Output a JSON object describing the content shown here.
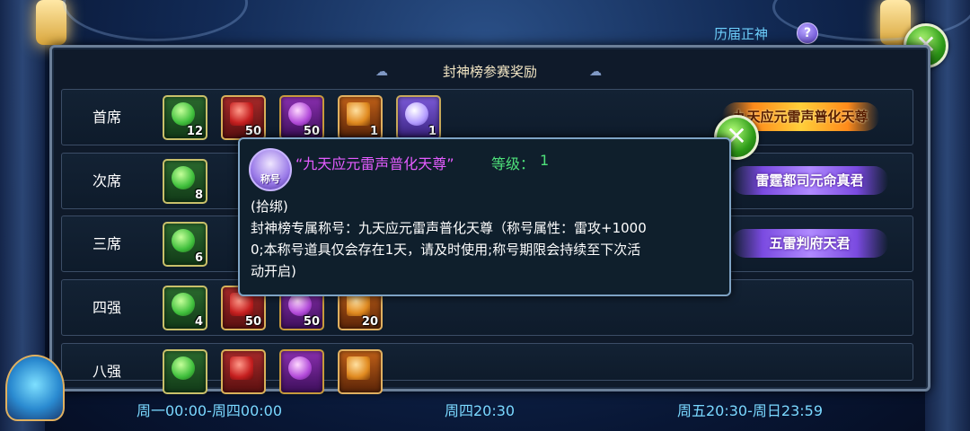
{
  "header": {
    "history_link": "历届正神",
    "help_icon": "question-icon"
  },
  "panel": {
    "title": "封神榜参赛奖励"
  },
  "ranks": [
    {
      "label": "首席",
      "items": [
        {
          "kind": "green",
          "count": "12"
        },
        {
          "kind": "red",
          "count": "50"
        },
        {
          "kind": "purple",
          "count": "50"
        },
        {
          "kind": "orange",
          "count": "1"
        },
        {
          "kind": "violet",
          "count": "1"
        }
      ],
      "badge": "九天应元雷声普化天尊"
    },
    {
      "label": "次席",
      "items": [
        {
          "kind": "green",
          "count": "8"
        }
      ],
      "badge": "雷霆都司元命真君"
    },
    {
      "label": "三席",
      "items": [
        {
          "kind": "green",
          "count": "6"
        }
      ],
      "badge": "五雷判府天君"
    },
    {
      "label": "四强",
      "items": [
        {
          "kind": "green",
          "count": "4"
        },
        {
          "kind": "red",
          "count": "50"
        },
        {
          "kind": "purple",
          "count": "50"
        },
        {
          "kind": "orange",
          "count": "20"
        }
      ],
      "badge": ""
    },
    {
      "label": "八强",
      "items": [
        {
          "kind": "green",
          "count": ""
        },
        {
          "kind": "red",
          "count": ""
        },
        {
          "kind": "purple",
          "count": ""
        },
        {
          "kind": "orange",
          "count": ""
        }
      ],
      "badge": ""
    }
  ],
  "tooltip": {
    "icon_label": "称号",
    "name": "“九天应元雷声普化天尊”",
    "level_label": "等级：",
    "level_value": "1",
    "lines": [
      "(拾绑)",
      "封神榜专属称号：九天应元雷声普化天尊（称号属性：雷攻+1000",
      "0;本称号道具仅会存在1天，请及时使用;称号期限会持续至下次活",
      "动开启)"
    ]
  },
  "footer": {
    "left": "周一00:00-周四00:00",
    "middle": "周四20:30",
    "right": "周五20:30-周日23:59"
  },
  "colors": {
    "tooltip_name": "#e45cff",
    "tooltip_level": "#4ee07a",
    "footer_text": "#7ad8ff",
    "close_button": "#2e9c18"
  }
}
